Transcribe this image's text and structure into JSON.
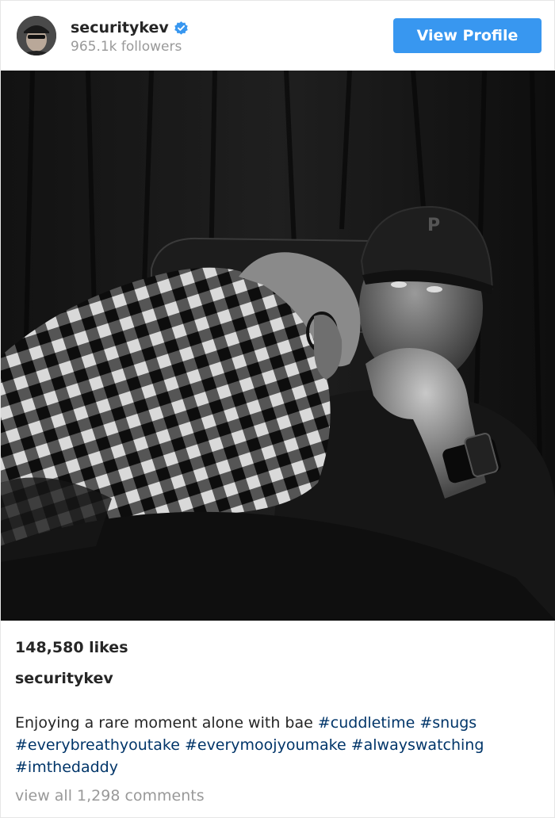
{
  "header": {
    "username": "securitykev",
    "followers": "965.1k followers",
    "view_profile_label": "View Profile",
    "verified_color": "#3897f0"
  },
  "post": {
    "likes": "148,580 likes",
    "author": "securitykev",
    "caption_text": "Enjoying a rare moment alone with bae",
    "hashtags": [
      "#cuddletime",
      "#snugs",
      "#everybreathyoutake",
      "#everymoojyoumake",
      "#alwayswatching",
      "#imthedaddy"
    ],
    "comments_link": "view all 1,298 comments"
  },
  "colors": {
    "accent": "#3897f0",
    "hashtag": "#003569",
    "muted": "#999999",
    "text": "#262626"
  }
}
